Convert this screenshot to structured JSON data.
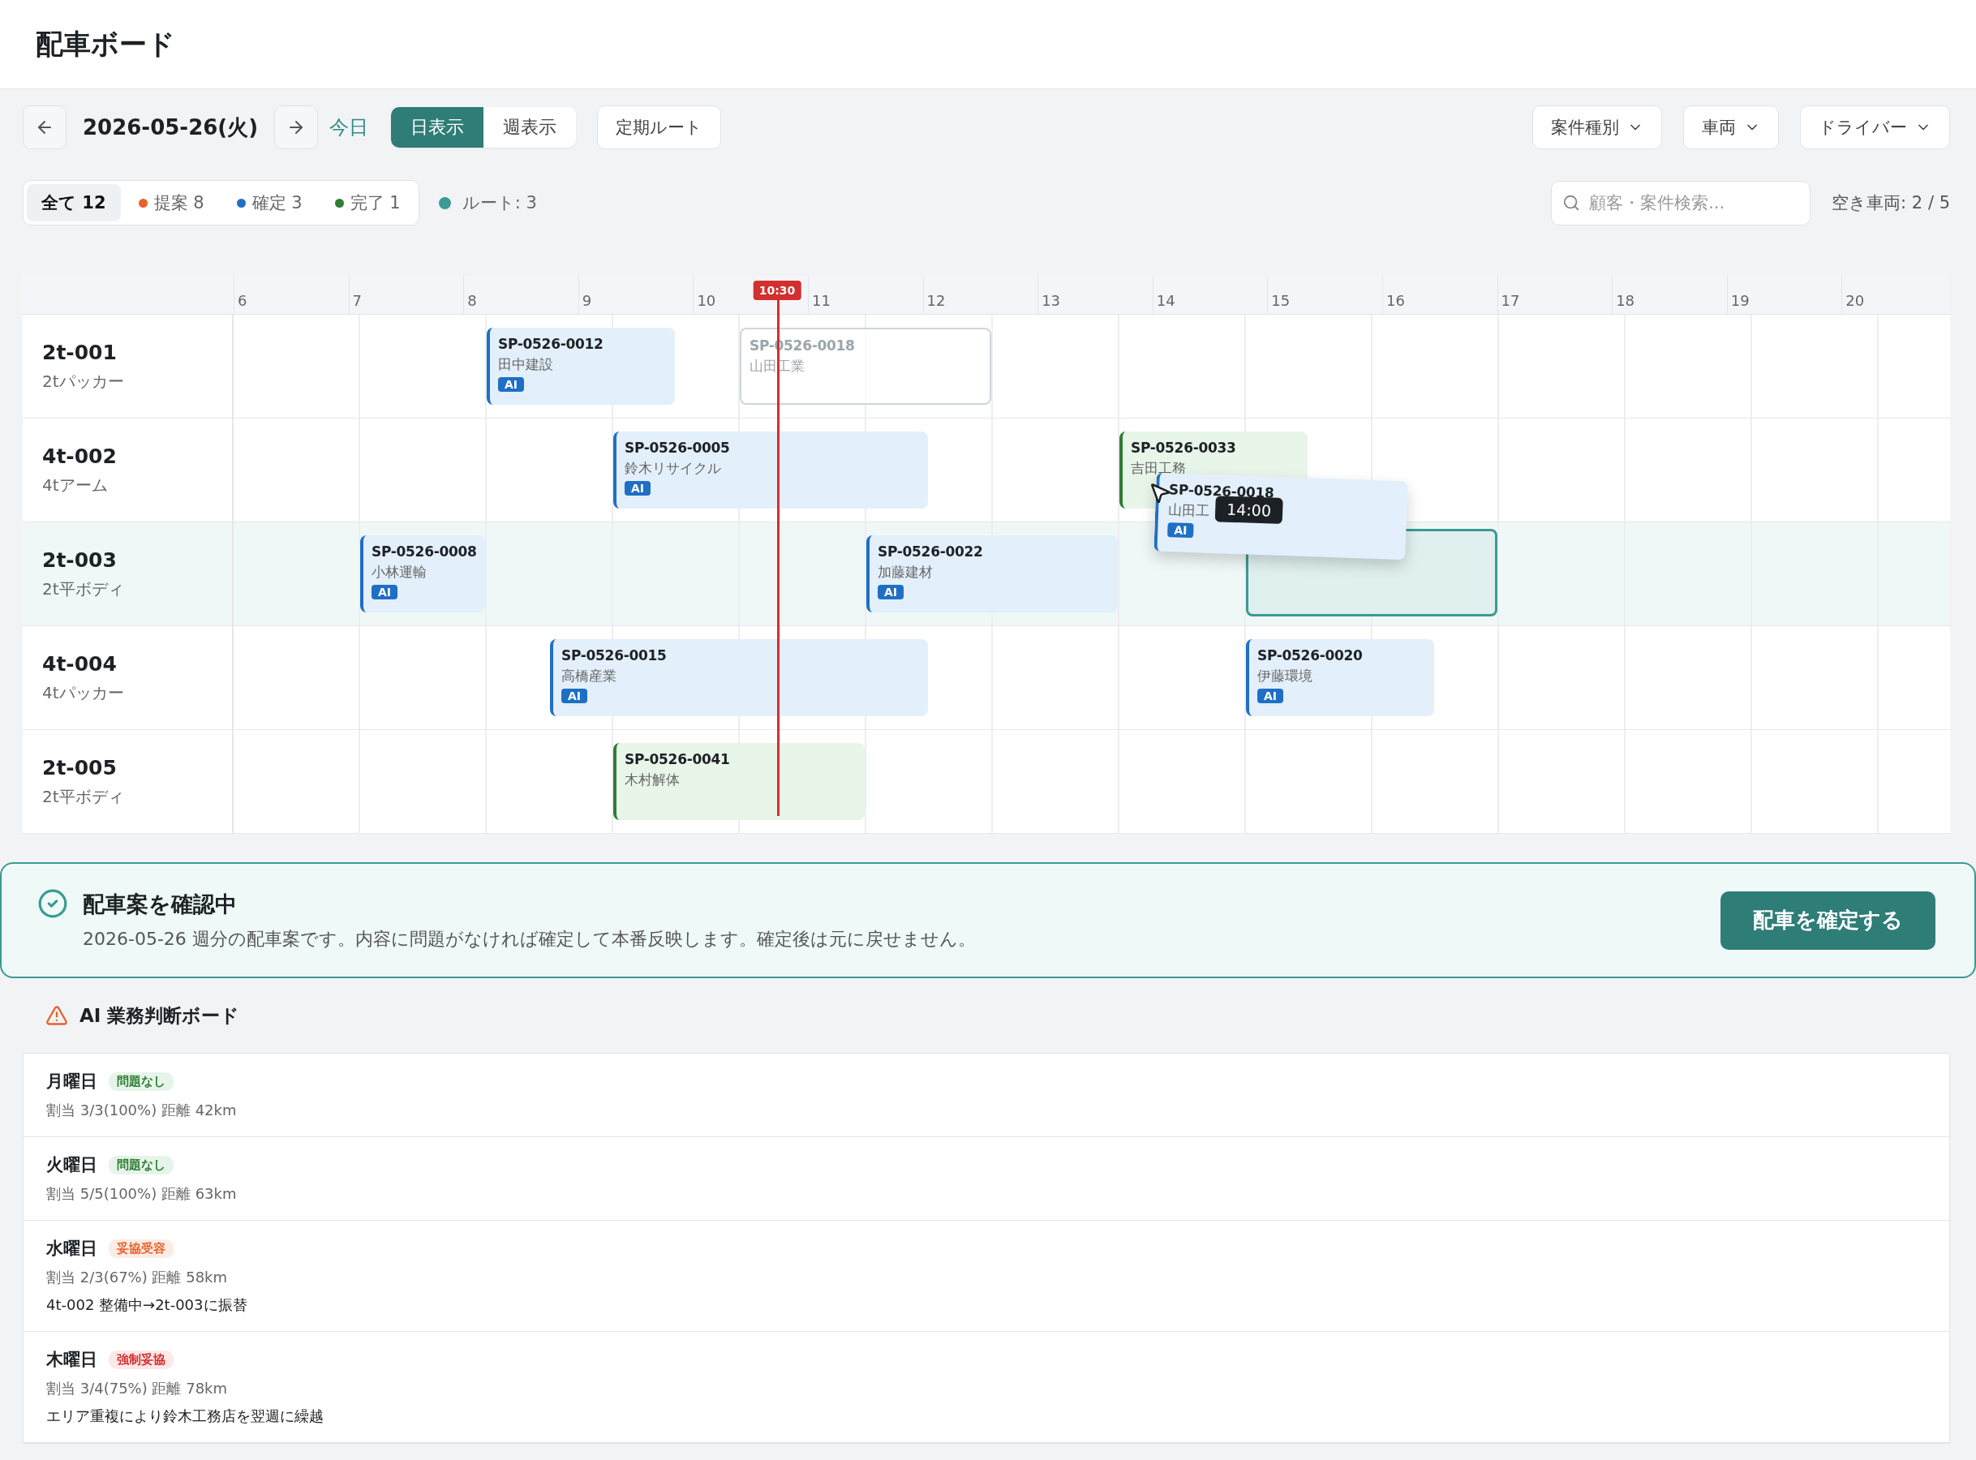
{
  "page_title": "配車ボード",
  "toolbar": {
    "date": "2026-05-26(火)",
    "today": "今日",
    "views": [
      {
        "label": "日表示",
        "selected": true
      },
      {
        "label": "週表示",
        "selected": false
      }
    ],
    "route_button": "定期ルート",
    "dropdowns": [
      "案件種別",
      "車両",
      "ドライバー"
    ]
  },
  "filters": [
    {
      "label": "全て 12",
      "selected": true
    },
    {
      "label": "提案 8",
      "color": "#e8622c",
      "selected": false
    },
    {
      "label": "確定 3",
      "color": "#1f6fc5",
      "selected": false
    },
    {
      "label": "完了 1",
      "color": "#2e7d32",
      "selected": false
    }
  ],
  "routes": {
    "label": "ルート: 3",
    "color": "#3a9a94"
  },
  "search": {
    "placeholder": "顧客・案件検索..."
  },
  "availability": "空き車両: 2 / 5",
  "timeline": {
    "hours": [
      "6",
      "7",
      "8",
      "9",
      "10",
      "11",
      "12",
      "13",
      "14",
      "15",
      "16",
      "17",
      "18",
      "19",
      "20"
    ],
    "now": "10:30",
    "vehicles": [
      {
        "name": "2t-001",
        "type": "2tパッカー",
        "highlighted": false,
        "jobs": [
          {
            "id": "SP-0526-0012",
            "customer": "田中建設",
            "kind": "confirmed",
            "badge": "AI"
          },
          {
            "id": "SP-0526-0018",
            "customer": "山田工業",
            "kind": "ghost"
          }
        ]
      },
      {
        "name": "4t-002",
        "type": "4tアーム",
        "highlighted": false,
        "jobs": [
          {
            "id": "SP-0526-0005",
            "customer": "鈴木リサイクル",
            "kind": "confirmed",
            "badge": "AI"
          },
          {
            "id": "SP-0526-0033",
            "customer": "吉田工務",
            "kind": "done"
          }
        ]
      },
      {
        "name": "2t-003",
        "type": "2t平ボディ",
        "highlighted": true,
        "jobs": [
          {
            "id": "SP-0526-0008",
            "customer": "小林運輸",
            "kind": "confirmed",
            "badge": "AI"
          },
          {
            "id": "SP-0526-0022",
            "customer": "加藤建材",
            "kind": "confirmed",
            "badge": "AI"
          }
        ]
      },
      {
        "name": "4t-004",
        "type": "4tパッカー",
        "highlighted": false,
        "jobs": [
          {
            "id": "SP-0526-0015",
            "customer": "高橋産業",
            "kind": "confirmed",
            "badge": "AI"
          },
          {
            "id": "SP-0526-0020",
            "customer": "伊藤環境",
            "kind": "confirmed",
            "badge": "AI"
          }
        ]
      },
      {
        "name": "2t-005",
        "type": "2t平ボディ",
        "highlighted": false,
        "jobs": [
          {
            "id": "SP-0526-0041",
            "customer": "木村解体",
            "kind": "done"
          }
        ]
      }
    ],
    "drag": {
      "id": "SP-0526-0018",
      "customer": "山田工",
      "badge": "AI",
      "time": "14:00"
    }
  },
  "banner": {
    "title": "配車案を確認中",
    "text": "2026-05-26 週分の配車案です。内容に問題がなければ確定して本番反映します。確定後は元に戻せません。",
    "button": "配車を確定する"
  },
  "ai_board": {
    "title": "AI 業務判断ボード",
    "days": [
      {
        "day": "月曜日",
        "kind": "ok",
        "badge": "問題なし",
        "summary": "割当 3/3(100%) 距離 42km"
      },
      {
        "day": "火曜日",
        "kind": "ok",
        "badge": "問題なし",
        "summary": "割当 5/5(100%) 距離 63km"
      },
      {
        "day": "水曜日",
        "kind": "compromise",
        "badge": "妥協受容",
        "summary": "割当 2/3(67%) 距離 58km",
        "note": "4t-002 整備中→2t-003に振替"
      },
      {
        "day": "木曜日",
        "kind": "forced",
        "badge": "強制妥協",
        "summary": "割当 3/4(75%) 距離 78km",
        "note": "エリア重複により鈴木工務店を翌週に繰越"
      }
    ]
  }
}
